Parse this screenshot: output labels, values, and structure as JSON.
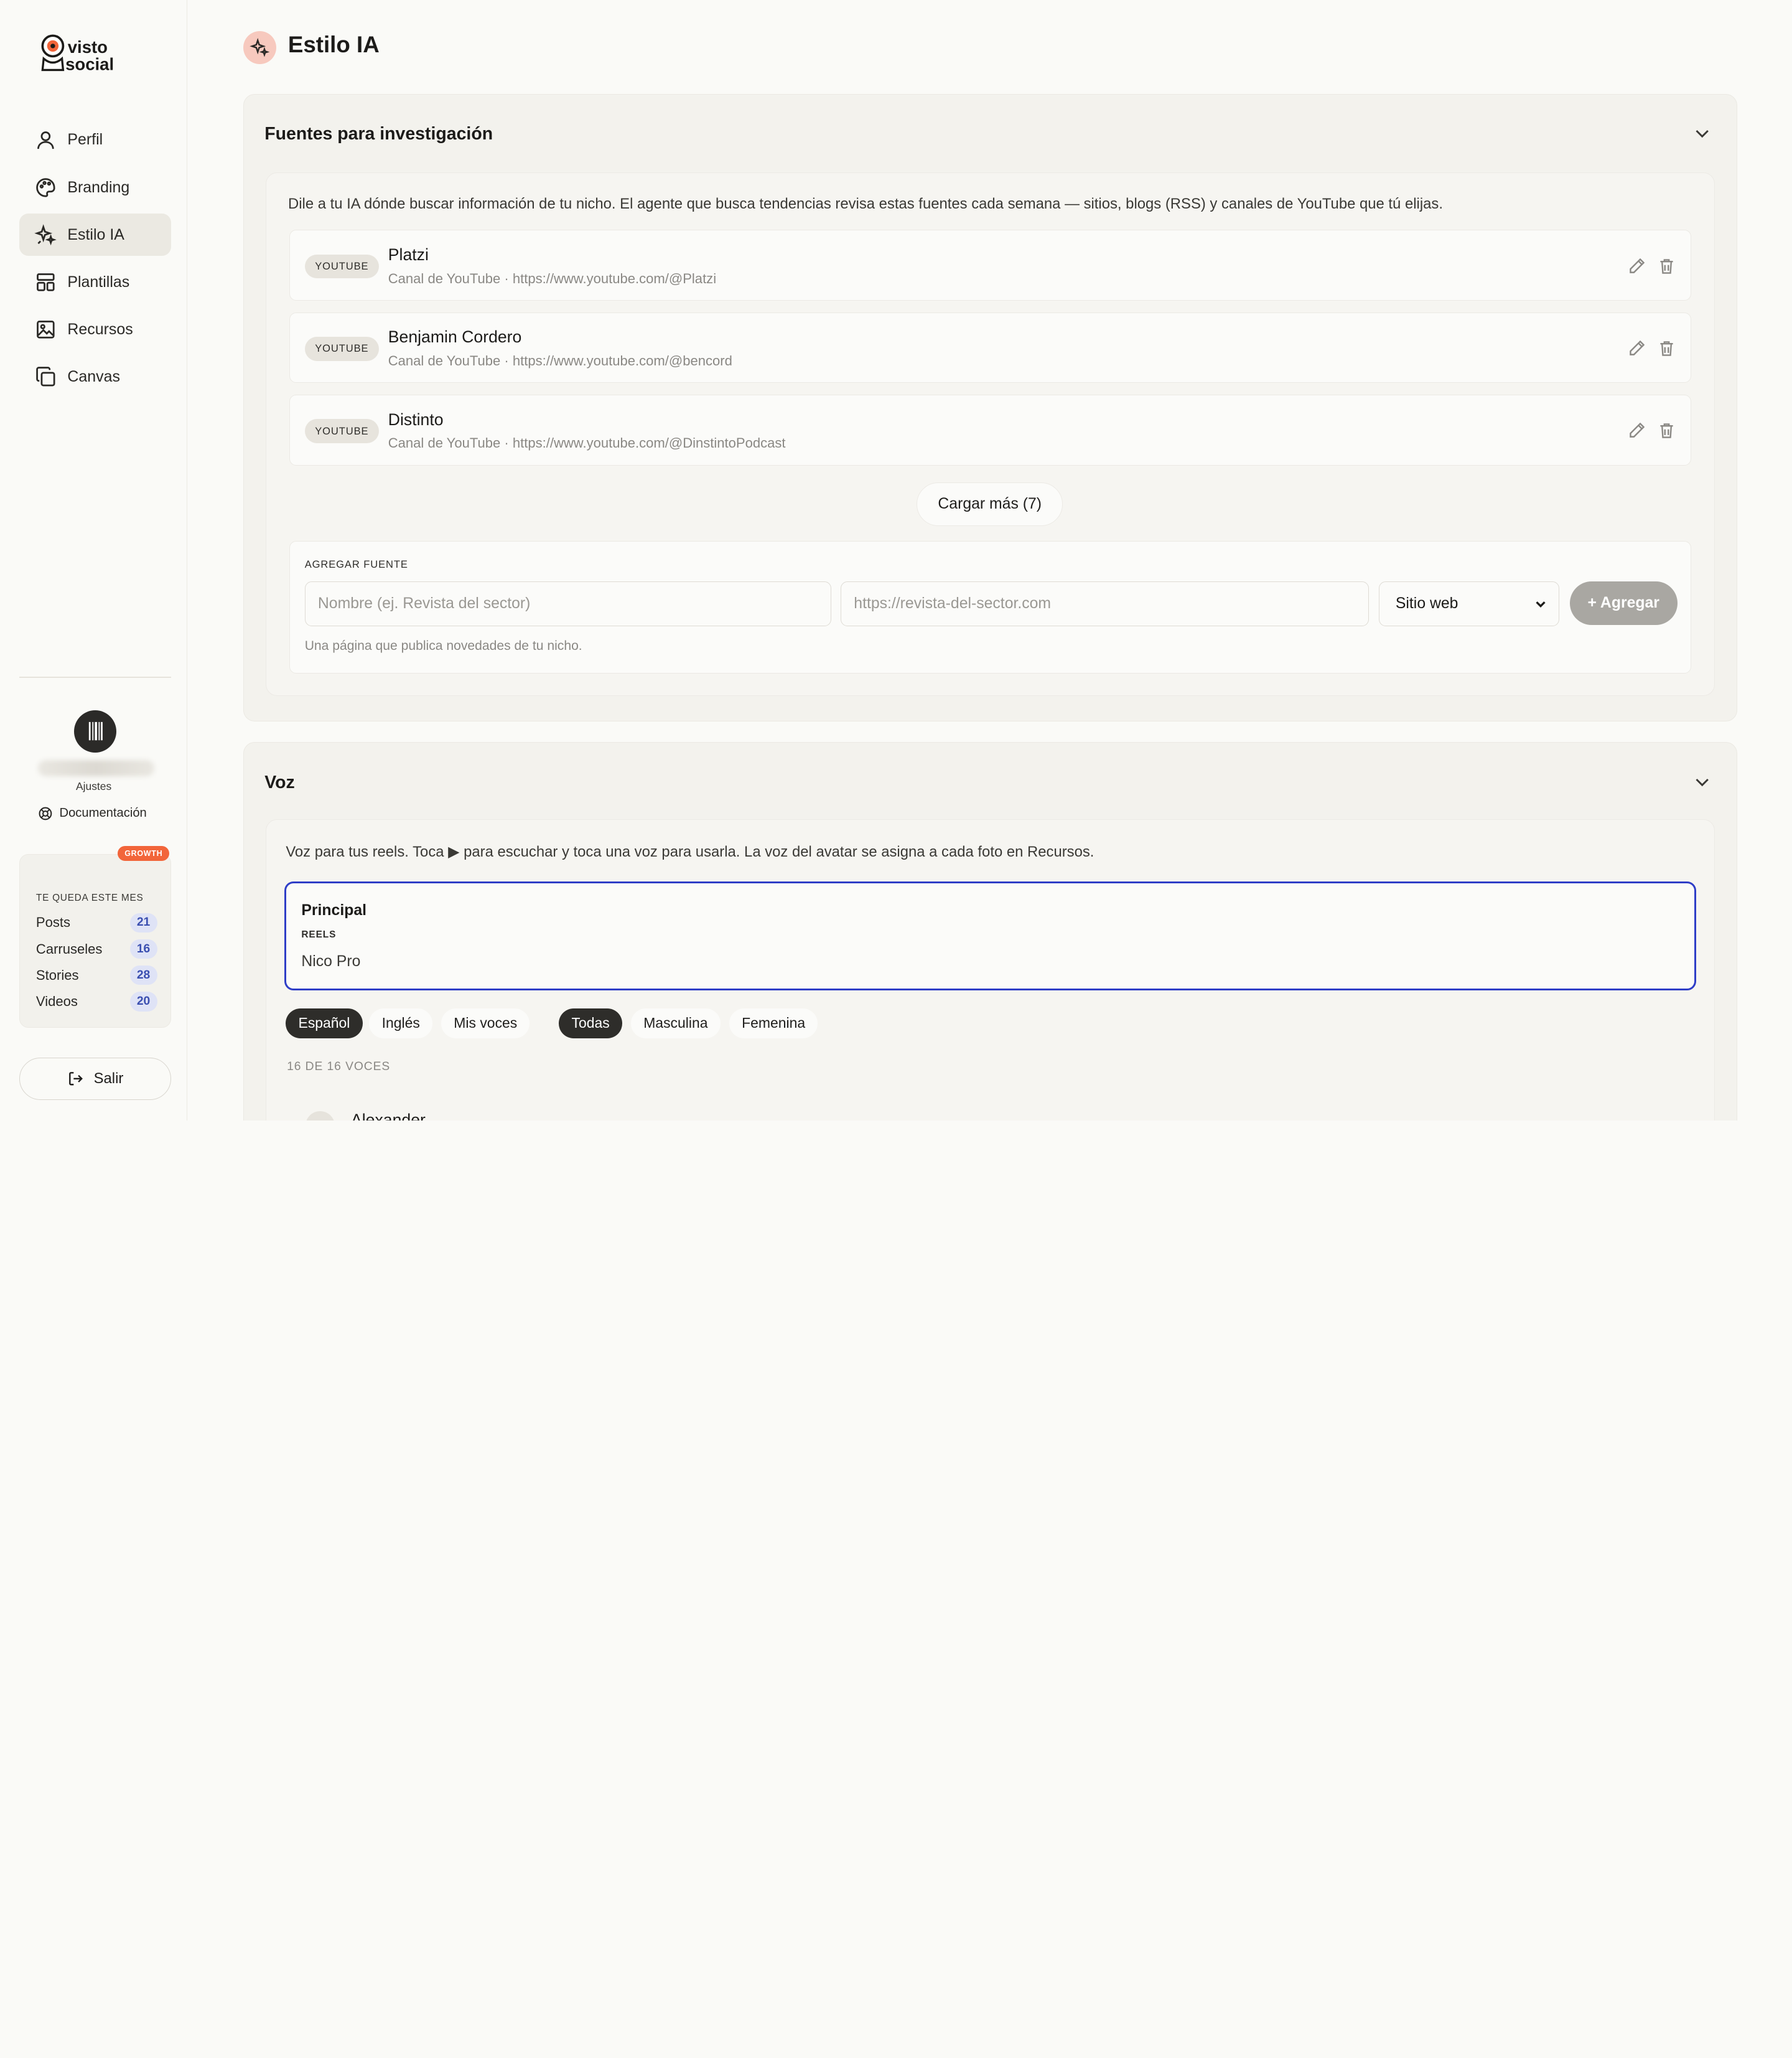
{
  "brand": {
    "logo_text": [
      "visto",
      "social"
    ]
  },
  "nav": {
    "items": [
      {
        "label": "Perfil",
        "icon": "user-icon",
        "active": false
      },
      {
        "label": "Branding",
        "icon": "palette-icon",
        "active": false
      },
      {
        "label": "Estilo IA",
        "icon": "sparkles-icon",
        "active": true
      },
      {
        "label": "Plantillas",
        "icon": "layout-icon",
        "active": false
      },
      {
        "label": "Recursos",
        "icon": "image-icon",
        "active": false
      },
      {
        "label": "Canvas",
        "icon": "copy-icon",
        "active": false
      }
    ]
  },
  "account": {
    "settings_label": "Ajustes",
    "docs_label": "Documentación"
  },
  "usage": {
    "plan_badge": "GROWTH",
    "title": "TE QUEDA ESTE MES",
    "rows": [
      {
        "label": "Posts",
        "count": "21"
      },
      {
        "label": "Carruseles",
        "count": "16"
      },
      {
        "label": "Stories",
        "count": "28"
      },
      {
        "label": "Videos",
        "count": "20"
      }
    ]
  },
  "logout_label": "Salir",
  "page": {
    "title": "Estilo IA"
  },
  "sources": {
    "title": "Fuentes para investigación",
    "description": "Dile a tu IA dónde buscar información de tu nicho. El agente que busca tendencias revisa estas fuentes cada semana — sitios, blogs (RSS) y canales de YouTube que tú elijas.",
    "items": [
      {
        "badge": "YOUTUBE",
        "name": "Platzi",
        "subtitle": "Canal de YouTube · https://www.youtube.com/@Platzi"
      },
      {
        "badge": "YOUTUBE",
        "name": "Benjamin Cordero",
        "subtitle": "Canal de YouTube · https://www.youtube.com/@bencord"
      },
      {
        "badge": "YOUTUBE",
        "name": "Distinto",
        "subtitle": "Canal de YouTube · https://www.youtube.com/@DinstintoPodcast"
      }
    ],
    "load_more": "Cargar más (7)",
    "add": {
      "label": "AGREGAR FUENTE",
      "name_placeholder": "Nombre (ej. Revista del sector)",
      "url_placeholder": "https://revista-del-sector.com",
      "type_value": "Sitio web",
      "button": "+ Agregar",
      "hint": "Una página que publica novedades de tu nicho."
    }
  },
  "voice": {
    "title": "Voz",
    "description": "Voz para tus reels. Toca ▶ para escuchar y toca una voz para usarla. La voz del avatar se asigna a cada foto en Recursos.",
    "selected": {
      "title": "Principal",
      "tag": "REELS",
      "name": "Nico Pro"
    },
    "language_filters": [
      {
        "label": "Español",
        "on": true
      },
      {
        "label": "Inglés",
        "on": false
      },
      {
        "label": "Mis voces",
        "on": false
      }
    ],
    "gender_filters": [
      {
        "label": "Todas",
        "on": true
      },
      {
        "label": "Masculina",
        "on": false
      },
      {
        "label": "Femenina",
        "on": false
      }
    ],
    "count_label": "16 DE 16 VOCES",
    "first_voice": "Alexander"
  },
  "colors": {
    "accent": "#2f3ec7",
    "badge": "#f2653a",
    "brand_icon_bg": "#f7c9be"
  }
}
